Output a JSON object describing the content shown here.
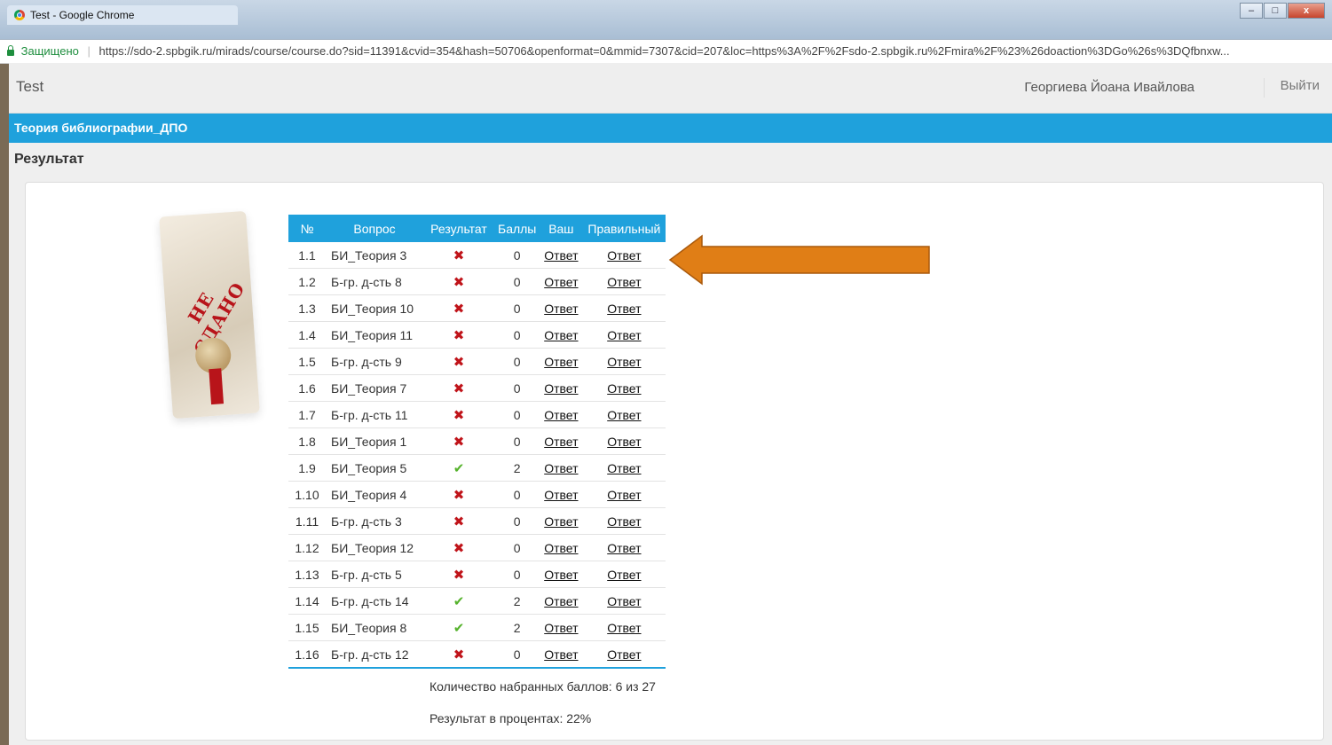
{
  "window": {
    "tab_title": "Test - Google Chrome",
    "buttons": [
      "–",
      "□",
      "x"
    ]
  },
  "address": {
    "secure_label": "Защищено",
    "url": "https://sdo-2.spbgik.ru/mirads/course/course.do?sid=11391&cvid=354&hash=50706&openformat=0&mmid=7307&cid=207&loc=https%3A%2F%2Fsdo-2.spbgik.ru%2Fmira%2F%23%26doaction%3DGo%26s%3DQfbnxw..."
  },
  "header": {
    "app_title": "Test",
    "user_name": "Георгиева Йоана Ивайлова",
    "logout_label": "Выйти"
  },
  "course_title": "Теория библиографии_ДПО",
  "section_title": "Результат",
  "stamp_text": "НЕ СДАНО",
  "table": {
    "headers": [
      "№",
      "Вопрос",
      "Результат",
      "Баллы",
      "Ваш",
      "Правильный"
    ],
    "rows": [
      {
        "num": "1.1",
        "question": "БИ_Теория 3",
        "result": "wrong",
        "score": "0",
        "yours": "Ответ",
        "correct": "Ответ"
      },
      {
        "num": "1.2",
        "question": "Б-гр. д-сть 8",
        "result": "wrong",
        "score": "0",
        "yours": "Ответ",
        "correct": "Ответ"
      },
      {
        "num": "1.3",
        "question": "БИ_Теория 10",
        "result": "wrong",
        "score": "0",
        "yours": "Ответ",
        "correct": "Ответ"
      },
      {
        "num": "1.4",
        "question": "БИ_Теория 11",
        "result": "wrong",
        "score": "0",
        "yours": "Ответ",
        "correct": "Ответ"
      },
      {
        "num": "1.5",
        "question": "Б-гр. д-сть 9",
        "result": "wrong",
        "score": "0",
        "yours": "Ответ",
        "correct": "Ответ"
      },
      {
        "num": "1.6",
        "question": "БИ_Теория 7",
        "result": "wrong",
        "score": "0",
        "yours": "Ответ",
        "correct": "Ответ"
      },
      {
        "num": "1.7",
        "question": "Б-гр. д-сть 11",
        "result": "wrong",
        "score": "0",
        "yours": "Ответ",
        "correct": "Ответ"
      },
      {
        "num": "1.8",
        "question": "БИ_Теория 1",
        "result": "wrong",
        "score": "0",
        "yours": "Ответ",
        "correct": "Ответ"
      },
      {
        "num": "1.9",
        "question": "БИ_Теория 5",
        "result": "correct",
        "score": "2",
        "yours": "Ответ",
        "correct": "Ответ"
      },
      {
        "num": "1.10",
        "question": "БИ_Теория 4",
        "result": "wrong",
        "score": "0",
        "yours": "Ответ",
        "correct": "Ответ"
      },
      {
        "num": "1.11",
        "question": "Б-гр. д-сть 3",
        "result": "wrong",
        "score": "0",
        "yours": "Ответ",
        "correct": "Ответ"
      },
      {
        "num": "1.12",
        "question": "БИ_Теория 12",
        "result": "wrong",
        "score": "0",
        "yours": "Ответ",
        "correct": "Ответ"
      },
      {
        "num": "1.13",
        "question": "Б-гр. д-сть 5",
        "result": "wrong",
        "score": "0",
        "yours": "Ответ",
        "correct": "Ответ"
      },
      {
        "num": "1.14",
        "question": "Б-гр. д-сть 14",
        "result": "correct",
        "score": "2",
        "yours": "Ответ",
        "correct": "Ответ"
      },
      {
        "num": "1.15",
        "question": "БИ_Теория 8",
        "result": "correct",
        "score": "2",
        "yours": "Ответ",
        "correct": "Ответ"
      },
      {
        "num": "1.16",
        "question": "Б-гр. д-сть 12",
        "result": "wrong",
        "score": "0",
        "yours": "Ответ",
        "correct": "Ответ"
      }
    ]
  },
  "summary": {
    "points": "Количество набранных баллов: 6 из 27",
    "percent": "Результат в процентах: 22%"
  },
  "icons": {
    "wrong_glyph": "✖",
    "correct_glyph": "✔"
  },
  "colors": {
    "accent": "#1fa1dc",
    "wrong": "#c0141a",
    "correct": "#55b22c",
    "arrow": "#e07e16"
  }
}
